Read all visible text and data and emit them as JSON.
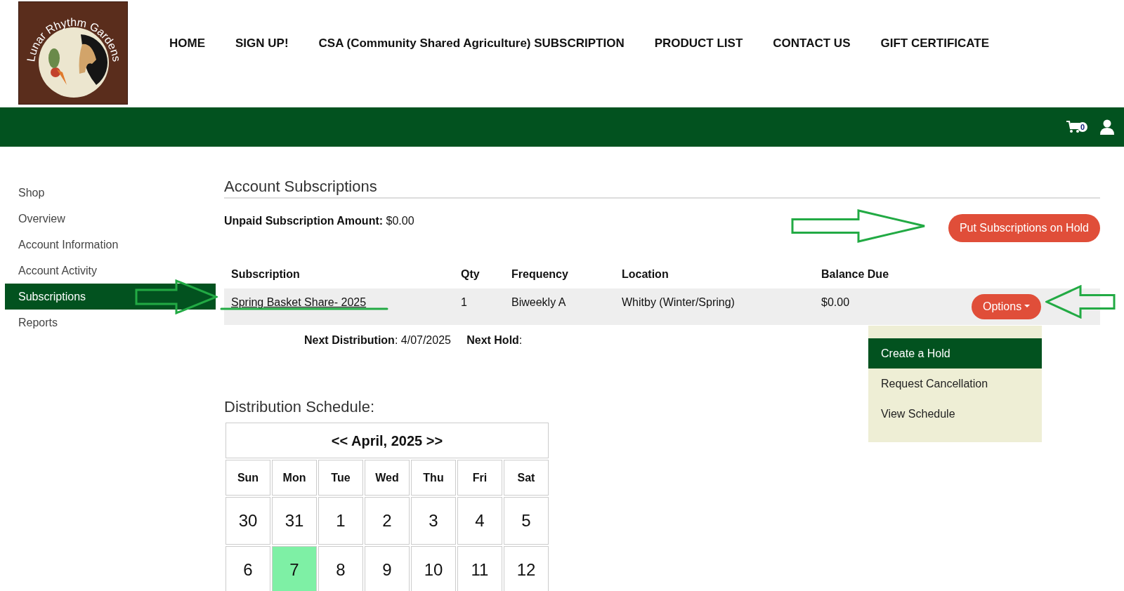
{
  "logo": {
    "text": "Lunar Rhythm Gardens"
  },
  "nav": [
    {
      "label": "HOME"
    },
    {
      "label": "SIGN UP!"
    },
    {
      "label": "CSA (Community Shared Agriculture) SUBSCRIPTION"
    },
    {
      "label": "PRODUCT LIST"
    },
    {
      "label": "CONTACT US"
    },
    {
      "label": "GIFT CERTIFICATE"
    }
  ],
  "cart": {
    "count": "0"
  },
  "sidebar": {
    "items": [
      {
        "label": "Shop",
        "selected": false
      },
      {
        "label": "Overview",
        "selected": false
      },
      {
        "label": "Account Information",
        "selected": false
      },
      {
        "label": "Account Activity",
        "selected": false
      },
      {
        "label": "Subscriptions",
        "selected": true
      },
      {
        "label": "Reports",
        "selected": false
      }
    ]
  },
  "title": "Account Subscriptions",
  "unpaid": {
    "label": "Unpaid Subscription Amount:",
    "value": "$0.00"
  },
  "hold_button": "Put Subscriptions on Hold",
  "table": {
    "columns": [
      "Subscription",
      "Qty",
      "Frequency",
      "Location",
      "Balance Due"
    ],
    "rows": [
      {
        "subscription": "Spring Basket Share- 2025",
        "qty": "1",
        "frequency": "Biweekly A",
        "location": "Whitby (Winter/Spring)",
        "balance": "$0.00",
        "options": "Options"
      }
    ]
  },
  "next": {
    "distribution_label": "Next Distribution",
    "distribution": ": 4/07/2025",
    "hold_label": "Next Hold",
    "hold": ":"
  },
  "menu": [
    {
      "label": "Create a Hold",
      "selected": true
    },
    {
      "label": "Request Cancellation",
      "selected": false
    },
    {
      "label": "View Schedule",
      "selected": false
    }
  ],
  "schedule": {
    "title": "Distribution Schedule:",
    "prev": "<<",
    "month": "April, 2025",
    "next": ">>",
    "weekdays": [
      "Sun",
      "Mon",
      "Tue",
      "Wed",
      "Thu",
      "Fri",
      "Sat"
    ],
    "weeks": [
      [
        {
          "day": "30",
          "selected": false
        },
        {
          "day": "31",
          "selected": false
        },
        {
          "day": "1",
          "selected": false
        },
        {
          "day": "2",
          "selected": false
        },
        {
          "day": "3",
          "selected": false
        },
        {
          "day": "4",
          "selected": false
        },
        {
          "day": "5",
          "selected": false
        }
      ],
      [
        {
          "day": "6",
          "selected": false
        },
        {
          "day": "7",
          "selected": true
        },
        {
          "day": "8",
          "selected": false
        },
        {
          "day": "9",
          "selected": false
        },
        {
          "day": "10",
          "selected": false
        },
        {
          "day": "11",
          "selected": false
        },
        {
          "day": "12",
          "selected": false
        }
      ]
    ]
  },
  "annotations": [
    {
      "kind": "arrow-right"
    },
    {
      "kind": "arrow-right"
    },
    {
      "kind": "underline"
    },
    {
      "kind": "arrow-left"
    }
  ]
}
